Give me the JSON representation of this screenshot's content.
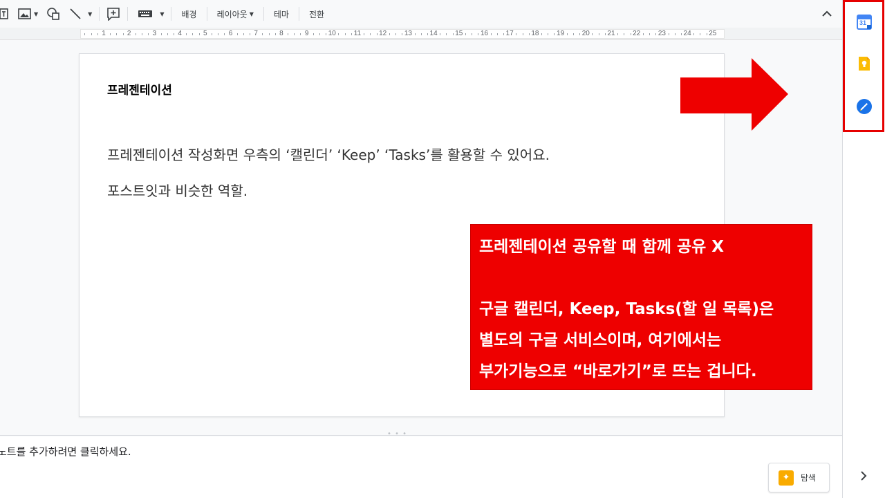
{
  "toolbar": {
    "background_label": "배경",
    "layout_label": "레이아웃",
    "theme_label": "테마",
    "transition_label": "전환"
  },
  "ruler": {
    "numbers": [
      "1",
      "2",
      "3",
      "4",
      "5",
      "6",
      "7",
      "8",
      "9",
      "10",
      "11",
      "12",
      "13",
      "14",
      "15",
      "16",
      "17",
      "18",
      "19",
      "20",
      "21",
      "22",
      "23",
      "24",
      "25"
    ]
  },
  "slide": {
    "title": "프레젠테이션",
    "body_line1": "프레젠테이션 작성화면 우측의 ‘캘린더’ ‘Keep’ ‘Tasks’를 활용할 수 있어요.",
    "body_line2": "포스트잇과 비슷한 역할."
  },
  "callout": {
    "line1": "프레젠테이션 공유할 때 함께 공유 X",
    "line2": "구글 캘린더, Keep, Tasks(할 일 목록)은",
    "line3": "별도의 구글 서비스이며, 여기에서는",
    "line4": "부가기능으로 “바로가기”로 뜨는 겁니다."
  },
  "notes": {
    "placeholder": "노트를 추가하려면 클릭하세요."
  },
  "explore": {
    "label": "탐색"
  },
  "side_panel": {
    "calendar_day": "31",
    "icons": [
      "calendar-icon",
      "keep-icon",
      "tasks-icon"
    ]
  },
  "colors": {
    "annotation_red": "#ee0000",
    "calendar_blue": "#4285f4",
    "keep_yellow": "#fbbc04",
    "tasks_blue": "#1a73e8"
  }
}
